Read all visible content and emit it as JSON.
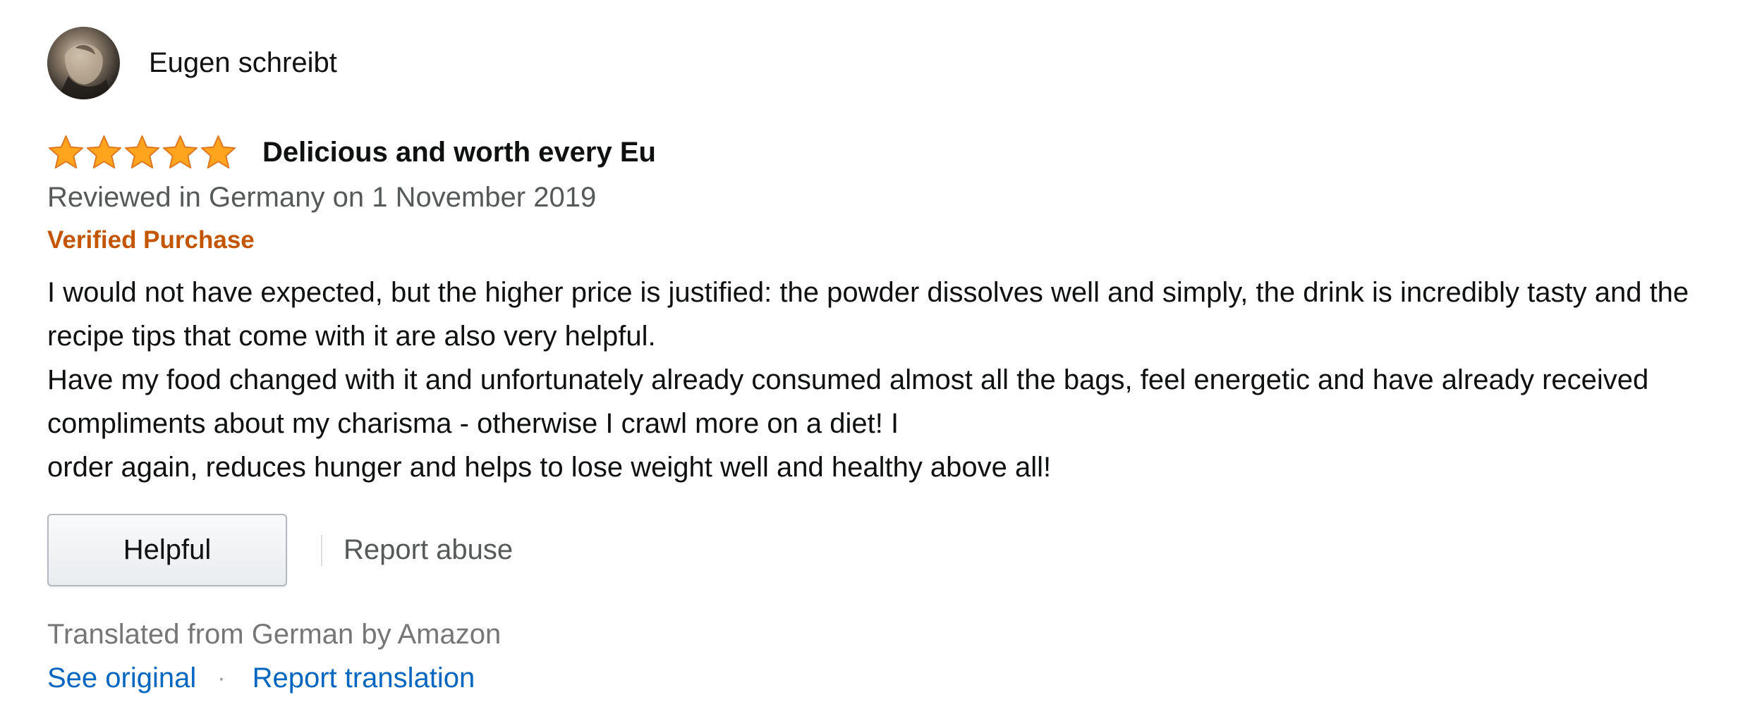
{
  "review": {
    "author": "Eugen schreibt",
    "rating": {
      "value": 5,
      "max": 5
    },
    "title": "Delicious and worth every Eu",
    "date_line": "Reviewed in Germany on 1 November 2019",
    "verified_label": "Verified Purchase",
    "body_lines": [
      "I would not have expected, but the higher price is justified: the powder dissolves well and simply, the drink is incredibly tasty and the recipe tips that come with it are also very helpful.",
      "Have my food changed with it and unfortunately already consumed almost all the bags, feel energetic and have already received compliments about my charisma - otherwise I crawl more on a diet! I",
      "order again, reduces hunger and helps to lose weight well and healthy above all!"
    ],
    "actions": {
      "helpful_label": "Helpful",
      "report_abuse_label": "Report abuse"
    },
    "translation": {
      "note": "Translated from German by Amazon",
      "see_original_label": "See original",
      "separator": "·",
      "report_translation_label": "Report translation"
    }
  },
  "icons": {
    "avatar": "avatar-photo",
    "star": "star-icon"
  },
  "colors": {
    "star_fill": "#ffa41c",
    "star_stroke": "#de7921",
    "verified": "#c45500",
    "link": "#0066c0",
    "muted_text": "#565959"
  }
}
